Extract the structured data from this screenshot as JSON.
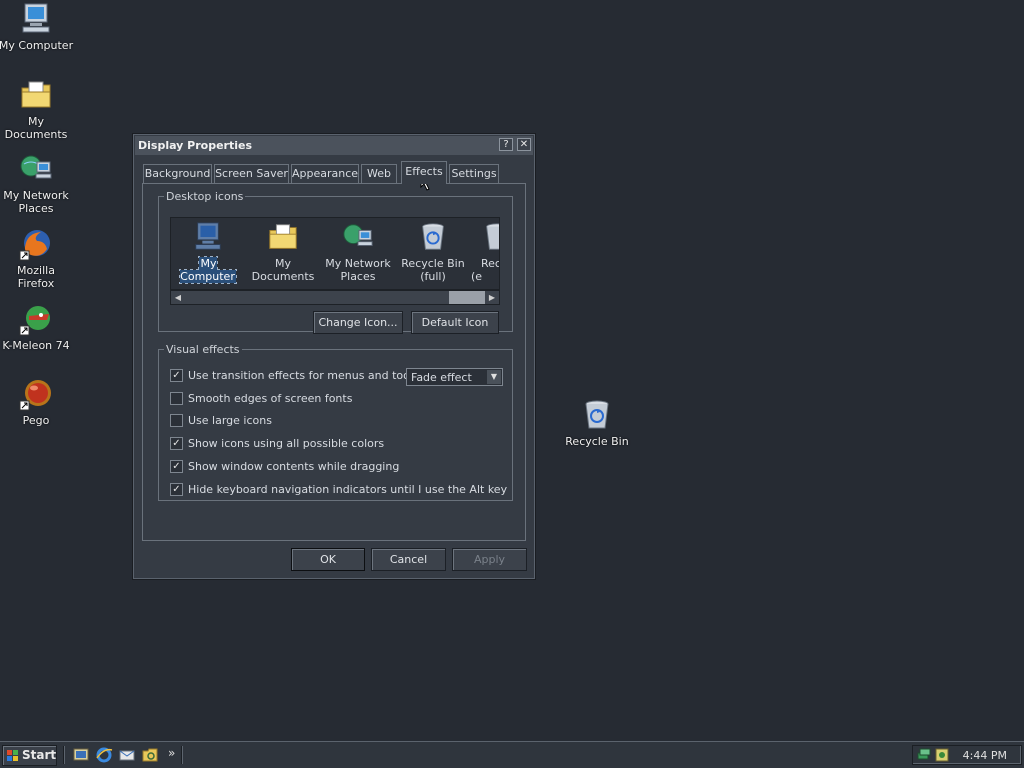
{
  "desktop": {
    "icons": [
      {
        "label": "My Computer",
        "icon": "computer-icon"
      },
      {
        "label": "My Documents",
        "icon": "folder-documents-icon"
      },
      {
        "label": "My Network Places",
        "icon": "network-places-icon"
      },
      {
        "label": "Mozilla Firefox",
        "icon": "firefox-icon"
      },
      {
        "label": "K-Meleon 74",
        "icon": "kmeleon-icon"
      },
      {
        "label": "Pego",
        "icon": "pego-icon"
      },
      {
        "label": "Recycle Bin",
        "icon": "recycle-bin-icon"
      }
    ]
  },
  "dialog": {
    "title": "Display Properties",
    "help_btn": "?",
    "close_btn": "✕",
    "tabs": [
      "Background",
      "Screen Saver",
      "Appearance",
      "Web",
      "Effects",
      "Settings"
    ],
    "active_tab": "Effects",
    "desktop_icons_group": {
      "legend": "Desktop icons",
      "items": [
        "My Computer",
        "My Documents",
        "My Network Places",
        "Recycle Bin (full)",
        "Rec (e"
      ],
      "selected": "My Computer",
      "change_icon": "Change Icon...",
      "default_icon": "Default Icon"
    },
    "visual_effects_group": {
      "legend": "Visual effects",
      "options": [
        {
          "label": "Use transition effects for menus and tooltips",
          "checked": true
        },
        {
          "label": "Smooth edges of screen fonts",
          "checked": false
        },
        {
          "label": "Use large icons",
          "checked": false
        },
        {
          "label": "Show icons using all possible colors",
          "checked": true
        },
        {
          "label": "Show window contents while dragging",
          "checked": true
        },
        {
          "label": "Hide keyboard navigation indicators until I use the Alt key",
          "checked": true
        }
      ],
      "transition_select_value": "Fade effect"
    },
    "ok": "OK",
    "cancel": "Cancel",
    "apply": "Apply"
  },
  "taskbar": {
    "start": "Start",
    "overflow": "»",
    "clock": "4:44 PM"
  },
  "checkmark": "✓"
}
